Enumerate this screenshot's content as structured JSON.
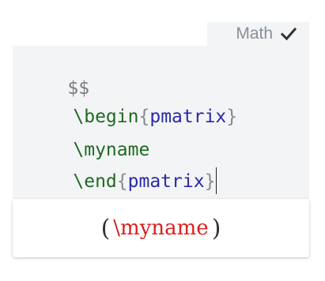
{
  "math_tag": {
    "label": "Math",
    "icon": "check-icon"
  },
  "editor": {
    "lines": [
      {
        "delim": "$$"
      },
      {
        "cmd": "\\begin",
        "brace_open": "{",
        "env": "pmatrix",
        "brace_close": "}"
      },
      {
        "cmd": "\\myname"
      },
      {
        "cmd": "\\end",
        "brace_open": "{",
        "env": "pmatrix",
        "brace_close": "}"
      },
      {
        "delim": "$$"
      }
    ]
  },
  "preview": {
    "open_paren": "(",
    "error_text": "\\myname",
    "close_paren": ")",
    "error_color": "#d91f1f"
  }
}
